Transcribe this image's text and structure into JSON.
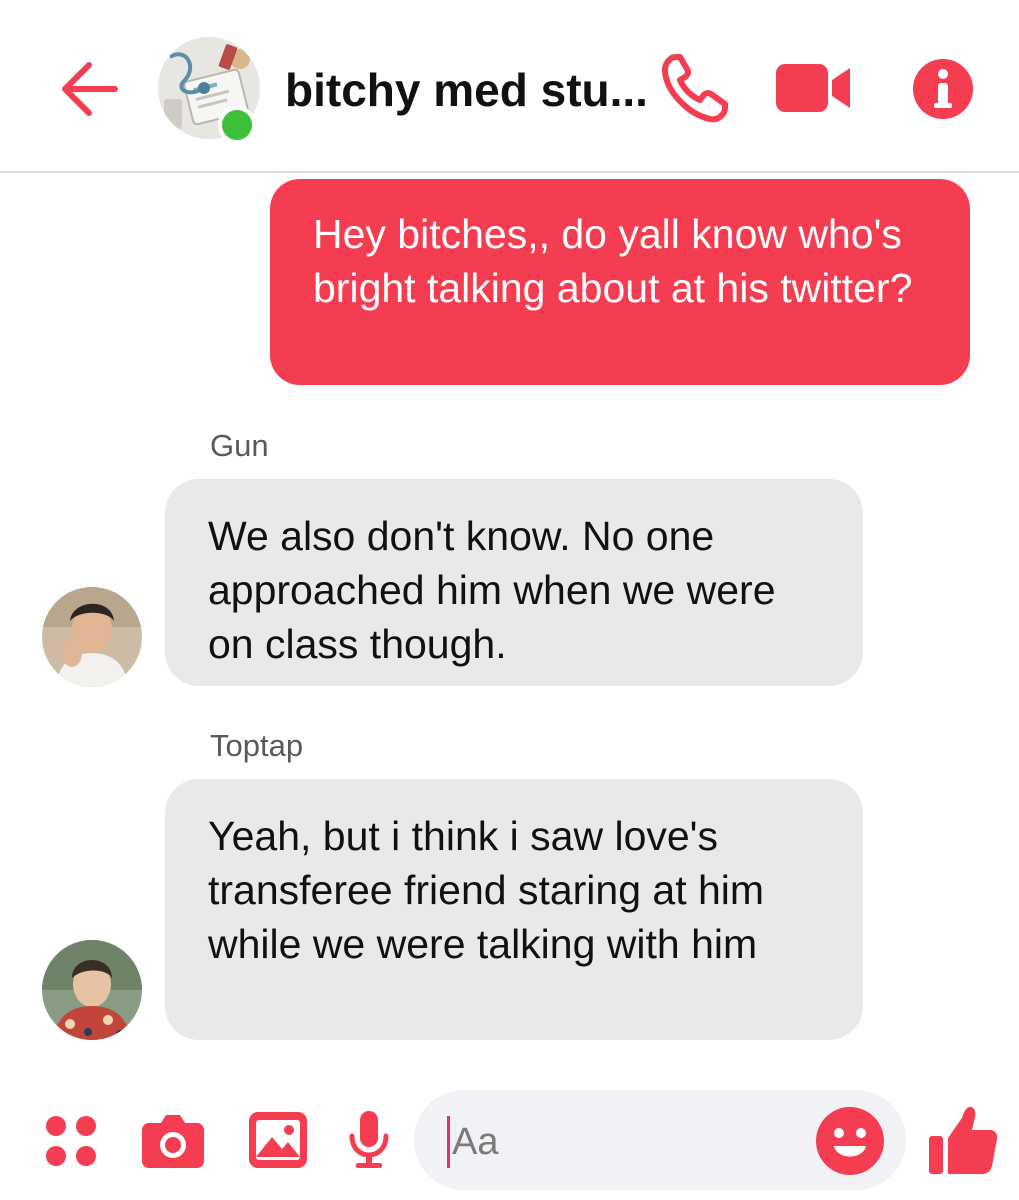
{
  "colors": {
    "accent": "#f53d52",
    "active_dot": "#3dc13a",
    "incoming_bubble": "#e9e9eb",
    "outgoing_text": "#ffffff",
    "caret": "#e0307a"
  },
  "header": {
    "title": "bitchy med stu...",
    "icons": [
      "back-arrow-icon",
      "phone-icon",
      "video-camera-icon",
      "info-icon"
    ]
  },
  "messages": [
    {
      "direction": "outgoing",
      "text": "Hey bitches,, do yall know who's bright talking about at his twitter?"
    },
    {
      "direction": "incoming",
      "sender": "Gun",
      "text": "We also don't know. No one approached him when we were on class though."
    },
    {
      "direction": "incoming",
      "sender": "Toptap",
      "text": "Yeah, but i think i saw love's transferee friend staring at him while we were talking with him"
    }
  ],
  "composer": {
    "placeholder": "Aa",
    "value": "",
    "icons": [
      "more-options-icon",
      "camera-icon",
      "image-icon",
      "microphone-icon",
      "emoji-icon",
      "thumbs-up-icon"
    ]
  }
}
